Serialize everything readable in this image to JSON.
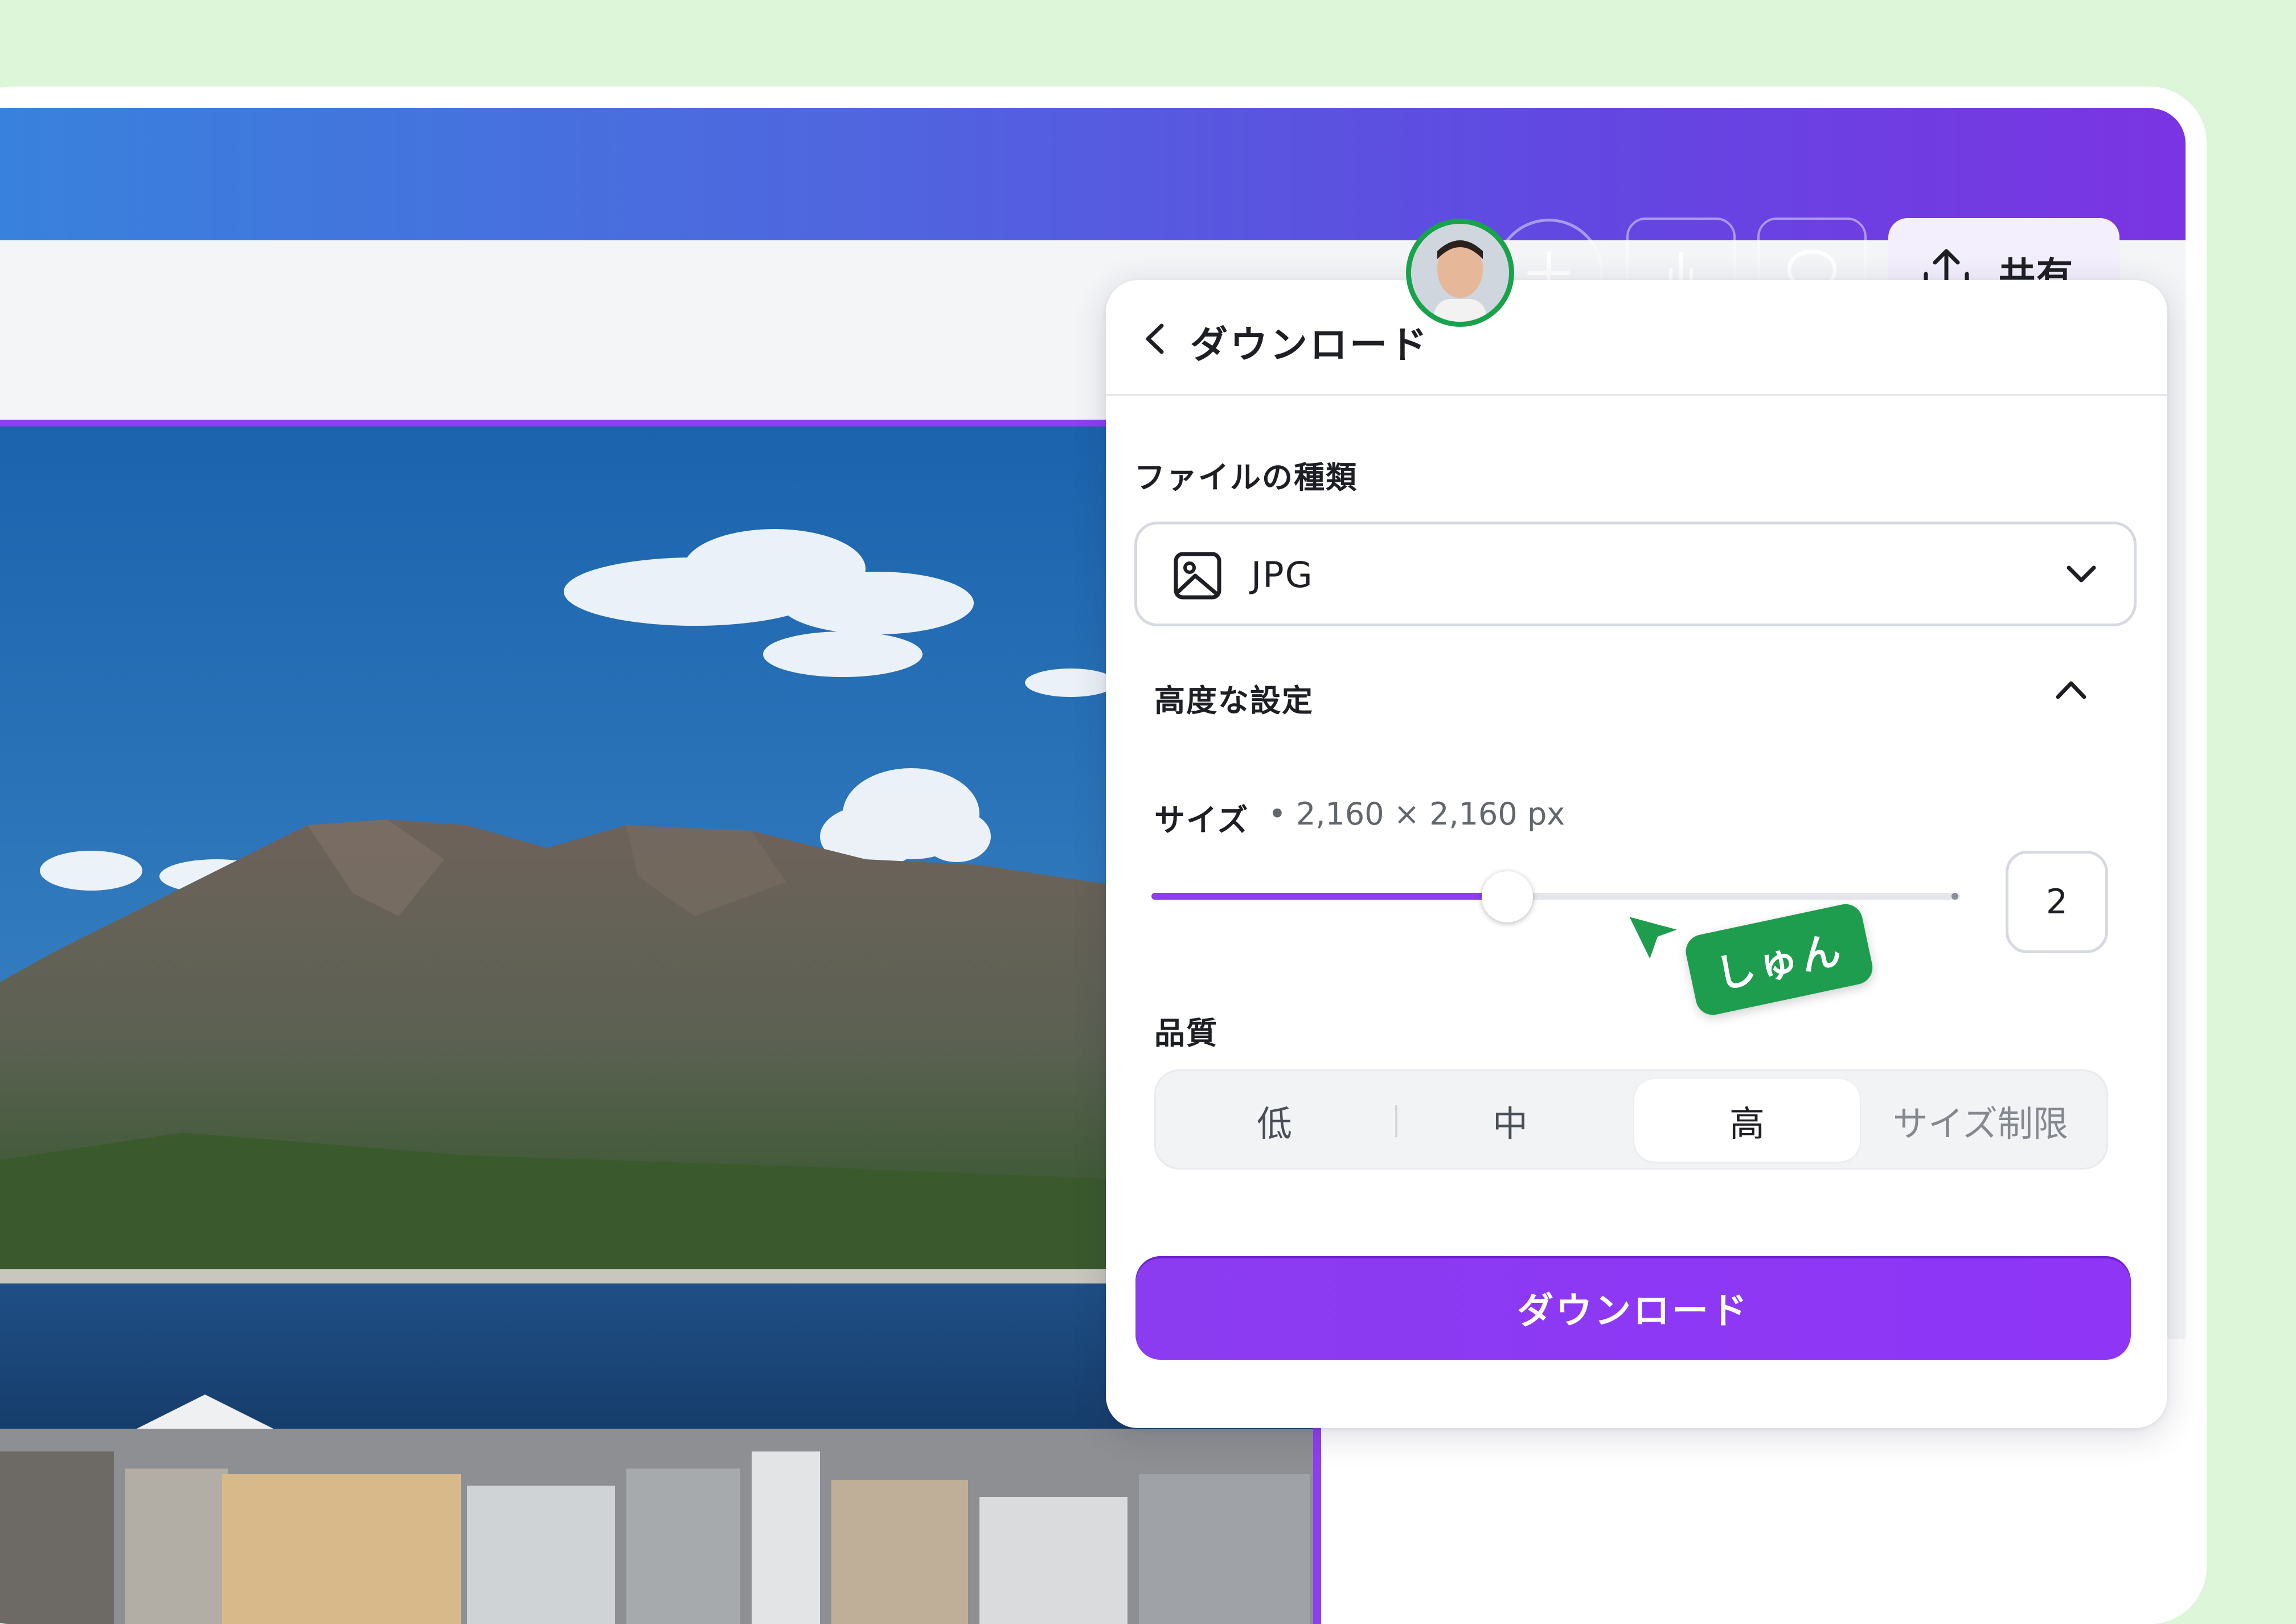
{
  "toolbar": {
    "share_label": "共有",
    "share_icon": "upload-icon",
    "insights_icon": "bar-chart-icon",
    "comment_icon": "comment-bubble-icon",
    "add_icon": "plus-icon"
  },
  "download_panel": {
    "title": "ダウンロード",
    "file_type": {
      "label": "ファイルの種類",
      "value": "JPG",
      "icon": "image-icon"
    },
    "advanced": {
      "label": "高度な設定",
      "expanded": true
    },
    "size": {
      "label": "サイズ",
      "meta": "• 2,160 × 2,160 px",
      "value": "2",
      "slider_fraction": 0.44
    },
    "quality": {
      "label": "品質",
      "options": [
        "低",
        "中",
        "高",
        "サイズ制限"
      ],
      "selected": "高"
    },
    "download_button_label": "ダウンロード"
  },
  "collaborator": {
    "name": "しゅん",
    "color": "#1f9d4e"
  },
  "colors": {
    "accent": "#8c3df1",
    "page_background": "#ddf6d9",
    "collaborator_green": "#1f9d4e"
  }
}
